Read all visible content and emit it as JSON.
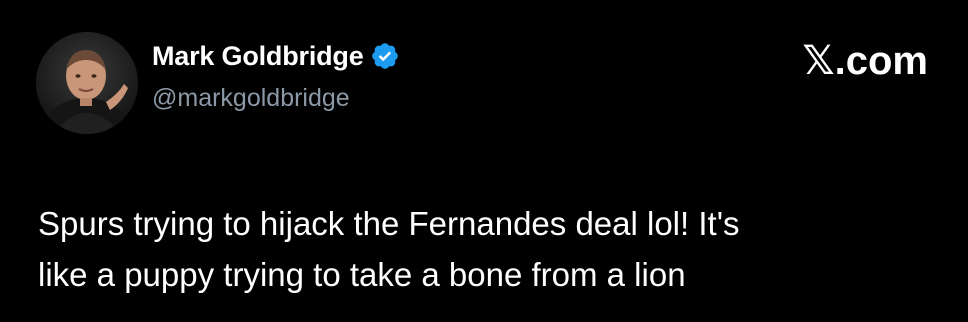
{
  "author": {
    "display_name": "Mark Goldbridge",
    "handle": "@markgoldbridge",
    "verified_icon": "verified-badge-icon",
    "avatar_icon": "profile-photo"
  },
  "site": {
    "label": "𝕏.com"
  },
  "tweet": {
    "lines": [
      "Spurs trying to hijack the Fernandes deal lol! It's",
      "like a puppy trying to take a bone from a lion"
    ]
  },
  "colors": {
    "background": "#000000",
    "text": "#ffffff",
    "handle": "#8b98a5",
    "verified": "#1d9bf0"
  }
}
